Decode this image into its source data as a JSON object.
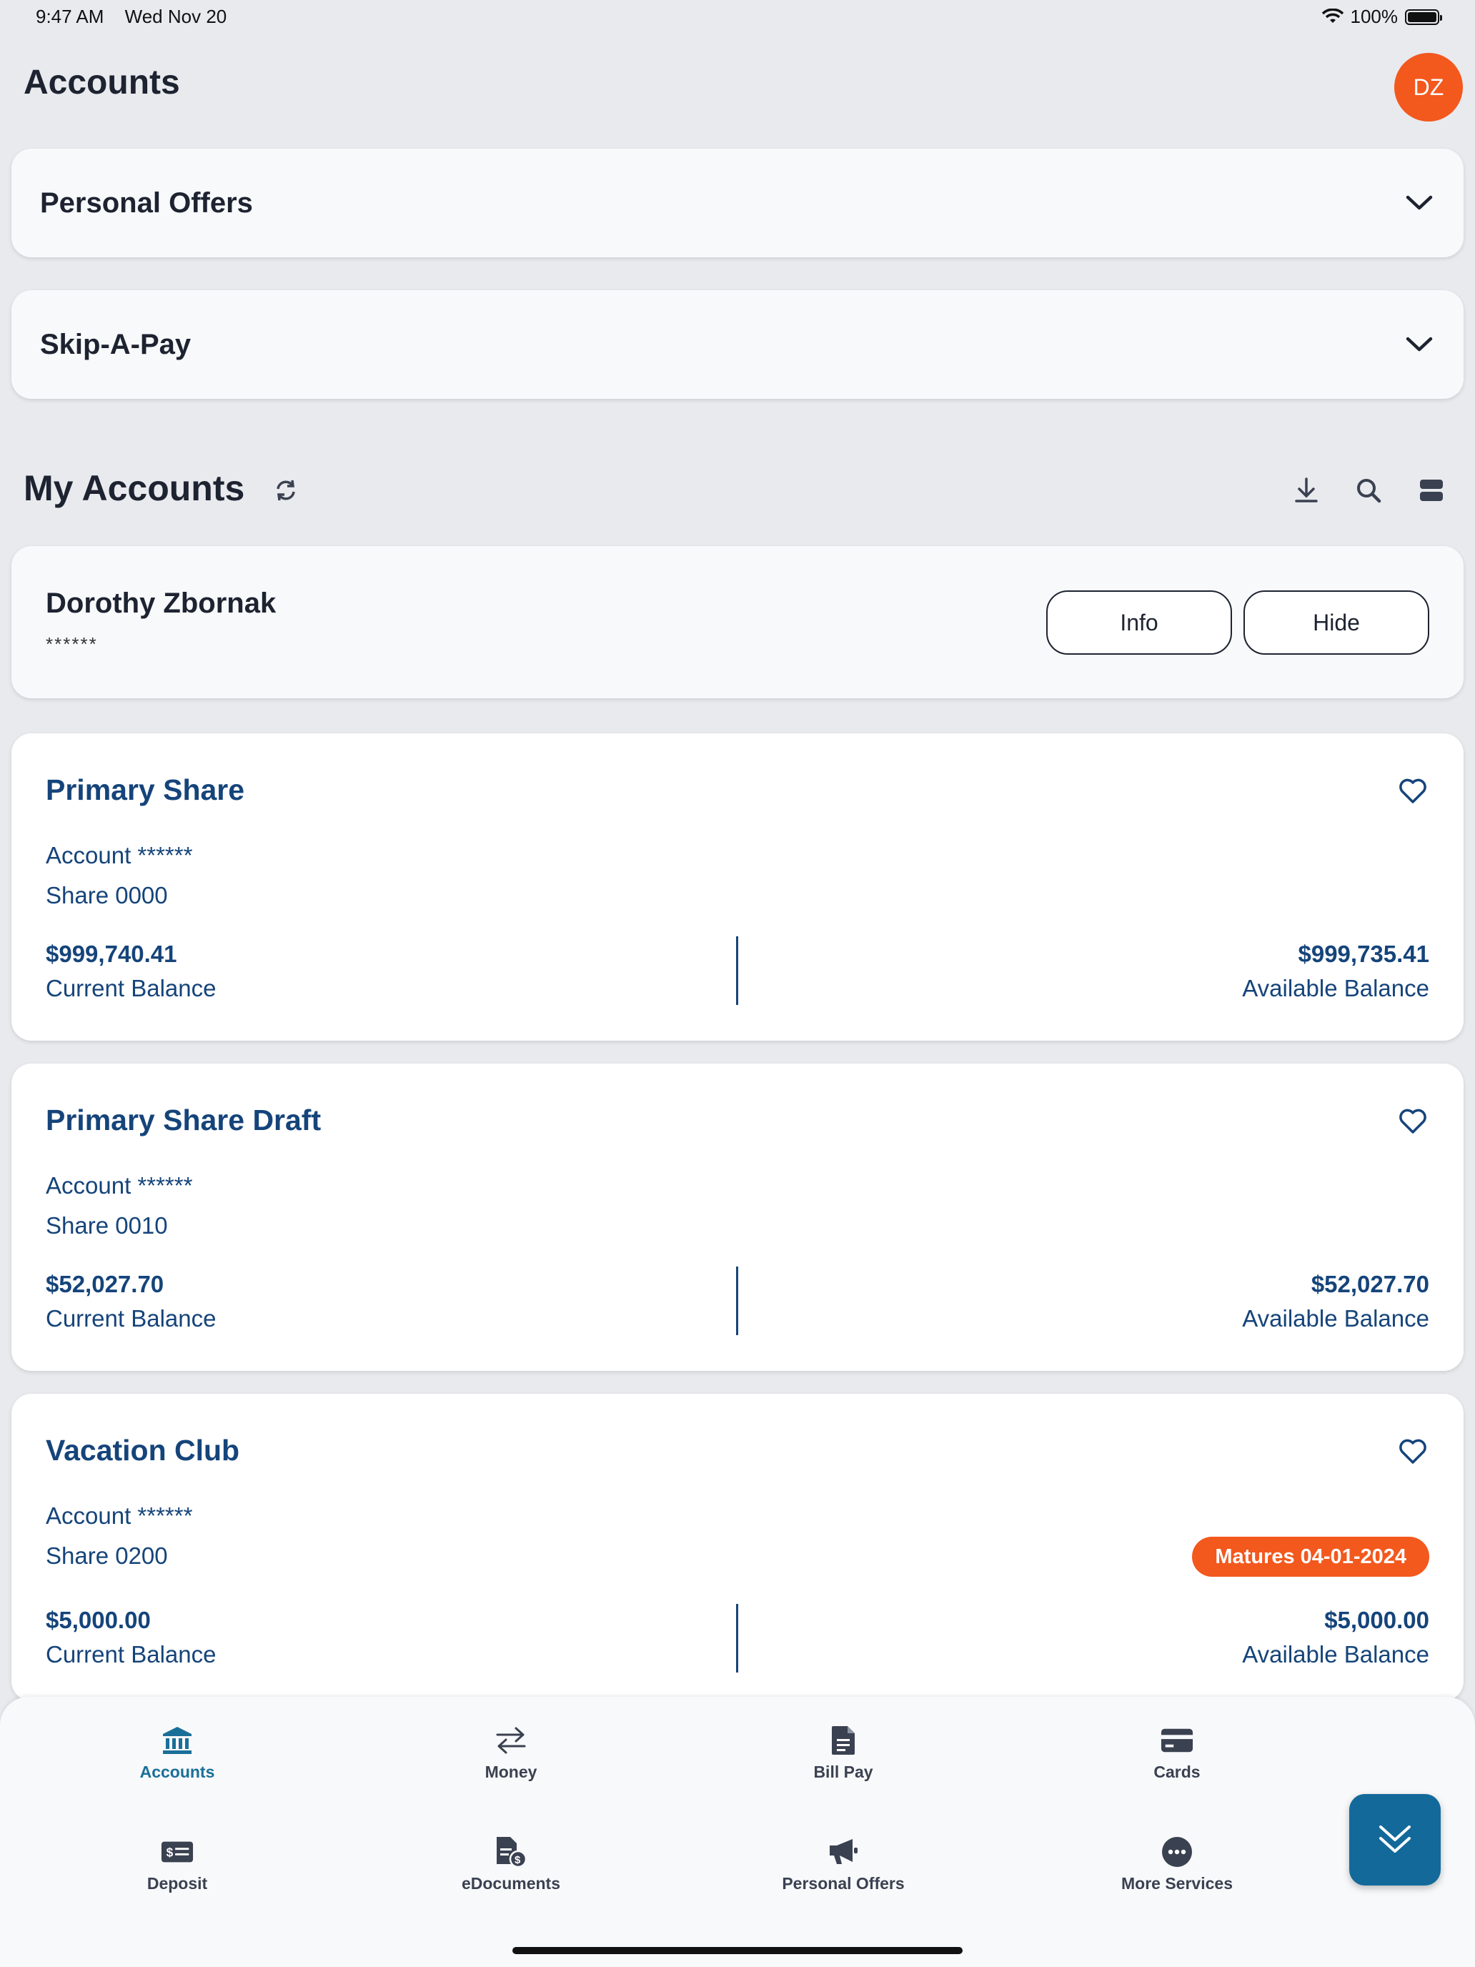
{
  "status_bar": {
    "time": "9:47 AM",
    "date": "Wed Nov 20",
    "battery": "100%"
  },
  "header": {
    "title": "Accounts",
    "avatar_initials": "DZ"
  },
  "panels": [
    {
      "title": "Personal Offers"
    },
    {
      "title": "Skip-A-Pay"
    }
  ],
  "my_accounts": {
    "title": "My Accounts",
    "member": {
      "name": "Dorothy Zbornak",
      "masked": "******",
      "info_label": "Info",
      "hide_label": "Hide"
    },
    "accounts": [
      {
        "name": "Primary Share",
        "account_line": "Account ******",
        "share_line": "Share 0000",
        "current_balance": "$999,740.41",
        "current_label": "Current Balance",
        "available_balance": "$999,735.41",
        "available_label": "Available Balance"
      },
      {
        "name": "Primary Share Draft",
        "account_line": "Account ******",
        "share_line": "Share 0010",
        "current_balance": "$52,027.70",
        "current_label": "Current Balance",
        "available_balance": "$52,027.70",
        "available_label": "Available Balance"
      },
      {
        "name": "Vacation Club",
        "account_line": "Account ******",
        "share_line": "Share 0200",
        "badge": "Matures 04-01-2024",
        "current_balance": "$5,000.00",
        "current_label": "Current Balance",
        "available_balance": "$5,000.00",
        "available_label": "Available Balance"
      }
    ]
  },
  "bottom_nav": {
    "items": [
      {
        "label": "Accounts",
        "icon": "bank-icon"
      },
      {
        "label": "Money",
        "icon": "transfer-icon"
      },
      {
        "label": "Bill Pay",
        "icon": "document-icon"
      },
      {
        "label": "Cards",
        "icon": "card-icon"
      },
      {
        "label": "Deposit",
        "icon": "check-deposit-icon"
      },
      {
        "label": "eDocuments",
        "icon": "edocument-icon"
      },
      {
        "label": "Personal Offers",
        "icon": "megaphone-icon"
      },
      {
        "label": "More Services",
        "icon": "more-icon"
      }
    ]
  },
  "colors": {
    "brand_navy": "#15447a",
    "accent_orange": "#f3581d",
    "fab_blue": "#13699a",
    "active_nav": "#1a6f98"
  }
}
